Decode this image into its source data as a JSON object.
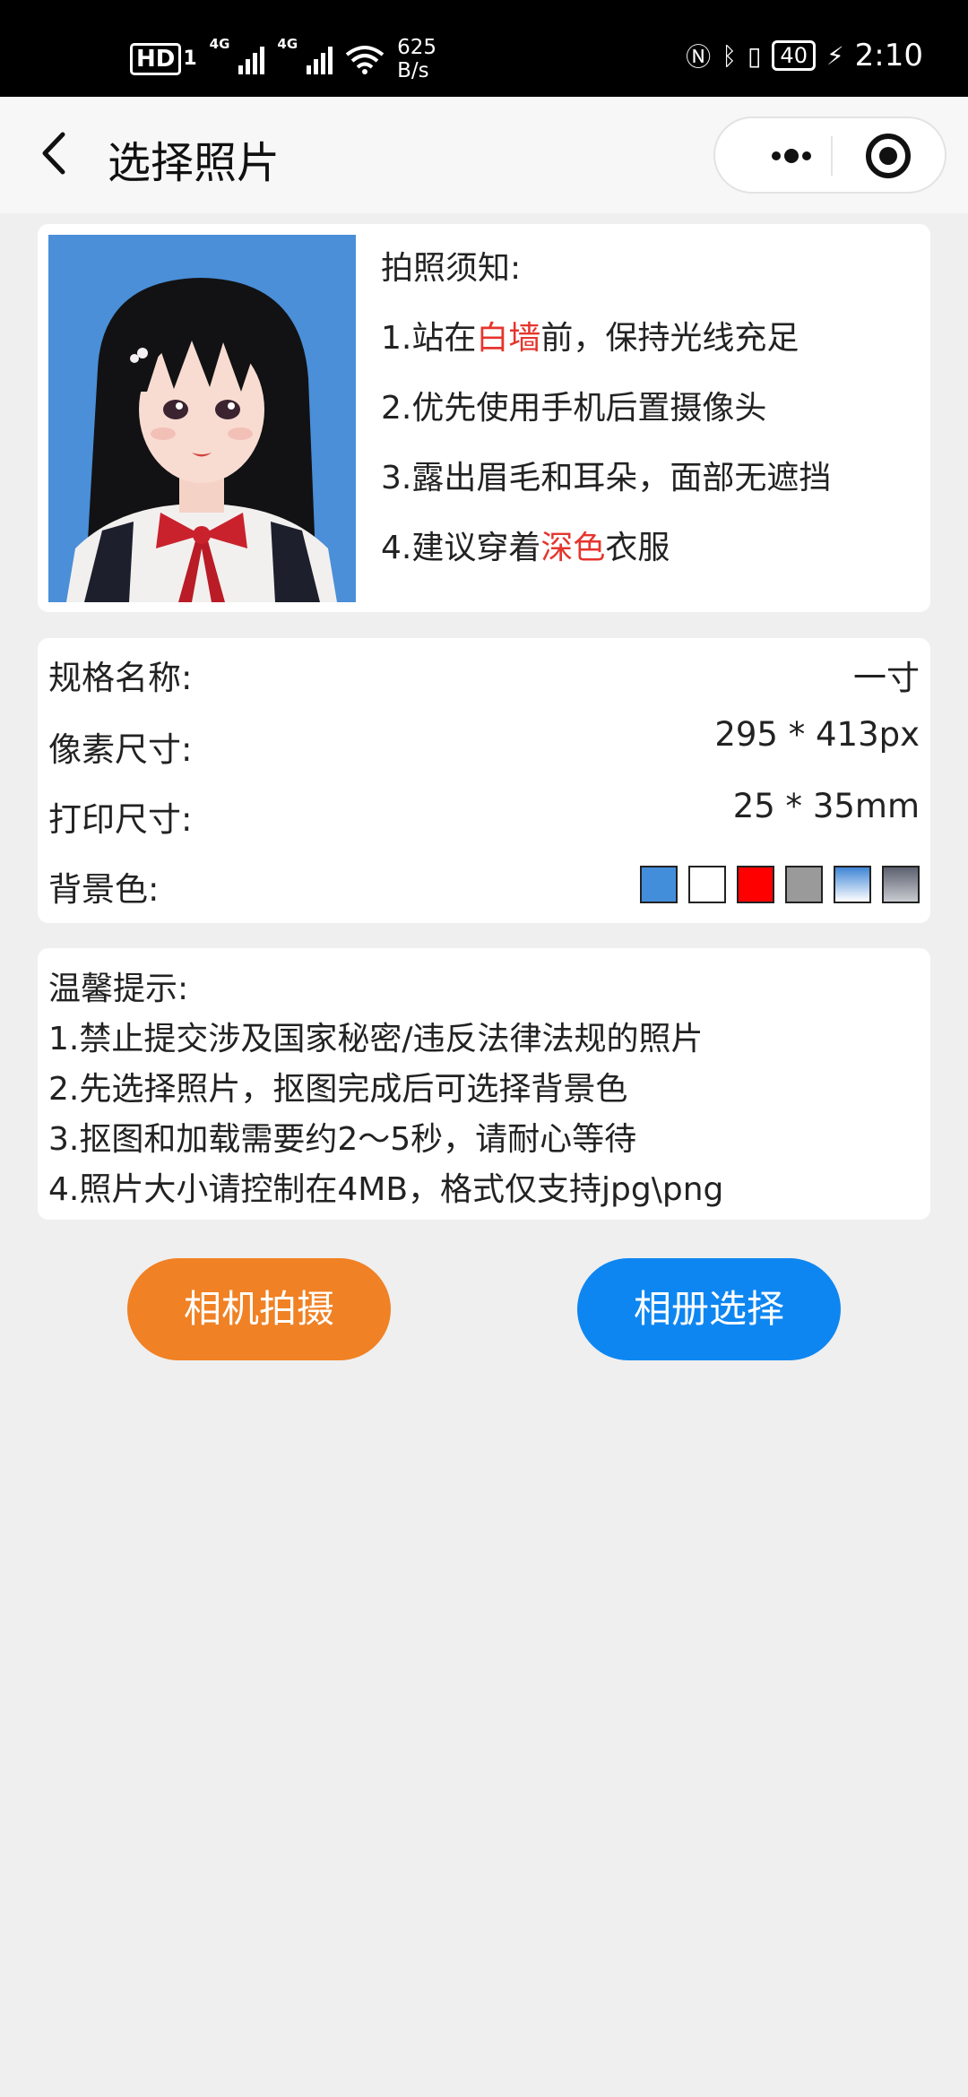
{
  "status_bar": {
    "hd": "HD",
    "sim": "1",
    "net1": "4G",
    "net2": "4G",
    "speed_value": "625",
    "speed_unit": "B/s",
    "battery": "40",
    "time": "2:10"
  },
  "nav": {
    "title": "选择照片"
  },
  "notice": {
    "heading": "拍照须知:",
    "line1_pre": "1.站在",
    "line1_hl": "白墙",
    "line1_post": "前，保持光线充足",
    "line2": "2.优先使用手机后置摄像头",
    "line3": "3.露出眉毛和耳朵，面部无遮挡",
    "line4_pre": "4.建议穿着",
    "line4_hl": "深色",
    "line4_post": "衣服",
    "highlight_color": "#e5352d"
  },
  "spec": {
    "name_label": "规格名称:",
    "name_value": "一寸",
    "pixel_label": "像素尺寸:",
    "pixel_value": "295 * 413px",
    "print_label": "打印尺寸:",
    "print_value": "25 * 35mm",
    "bg_label": "背景色:",
    "bg_colors": [
      "#438edb",
      "#ffffff",
      "#ff0000",
      "#9a9a9a",
      "gradient-blue",
      "gradient-gray"
    ]
  },
  "tips": {
    "heading": "温馨提示:",
    "line1": "1.禁止提交涉及国家秘密/违反法律法规的照片",
    "line2": "2.先选择照片，抠图完成后可选择背景色",
    "line3": "3.抠图和加载需要约2～5秒，请耐心等待",
    "line4": "4.照片大小请控制在4MB，格式仅支持jpg\\png"
  },
  "buttons": {
    "camera": "相机拍摄",
    "album": "相册选择",
    "camera_color": "#f08124",
    "album_color": "#0e86f1"
  }
}
